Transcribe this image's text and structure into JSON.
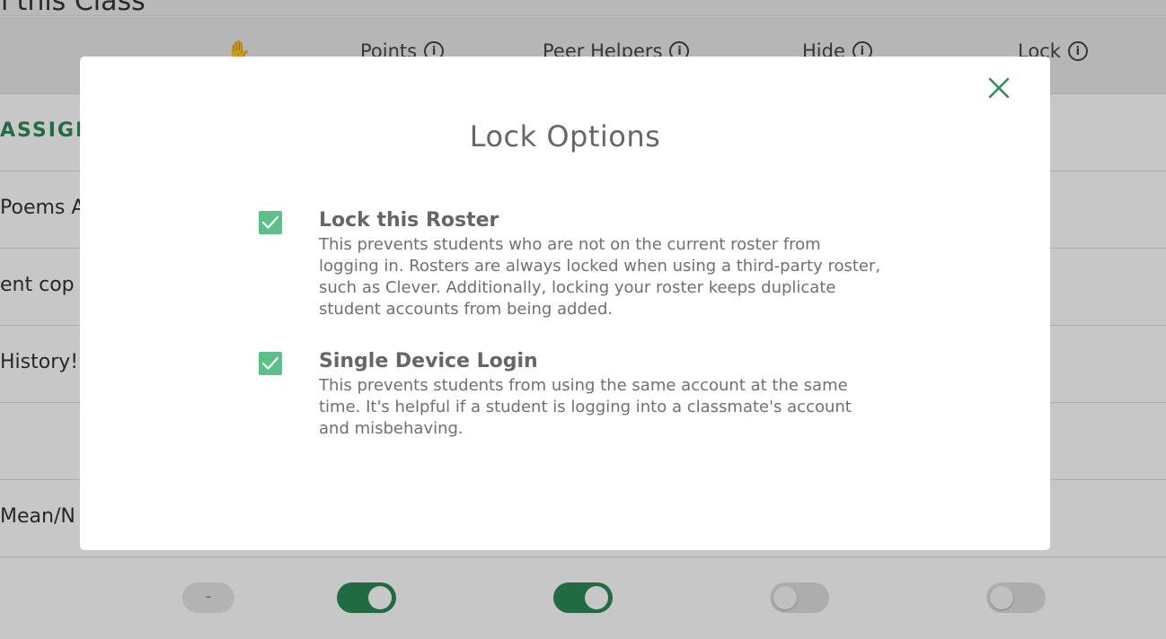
{
  "background": {
    "page_title": "n this Class",
    "columns": {
      "points": "Points",
      "peer_helpers": "Peer Helpers",
      "hide": "Hide",
      "lock": "Lock"
    },
    "rows": [
      {
        "text": "ASSIGNM"
      },
      {
        "text": "Poems A"
      },
      {
        "text": "ent cop"
      },
      {
        "text": "History!"
      },
      {
        "text": ""
      },
      {
        "text": " Mean/N"
      }
    ],
    "toggles": {
      "dash": "-",
      "points": "on",
      "peer_helpers": "on",
      "hide": "off",
      "lock": "off"
    }
  },
  "modal": {
    "title": "Lock Options",
    "options": [
      {
        "label": "Lock this Roster",
        "checked": true,
        "description": "This prevents students who are not on the current roster from logging in. Rosters are always locked when using a third-party roster, such as Clever. Additionally, locking your roster keeps duplicate student accounts from being added."
      },
      {
        "label": "Single Device Login",
        "checked": true,
        "description": "This prevents students from using the same account at the same time. It's helpful if a student is logging into a classmate's account and misbehaving."
      }
    ]
  },
  "colors": {
    "accent_green": "#2a8a55",
    "checkbox_green": "#5dc089",
    "overlay": "rgba(0,0,0,0.22)"
  }
}
